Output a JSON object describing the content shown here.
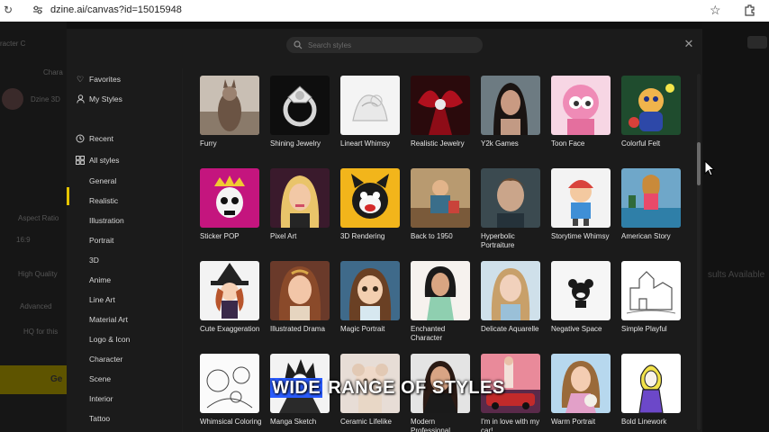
{
  "browser": {
    "url": "dzine.ai/canvas?id=15015948"
  },
  "background": {
    "left_texts": [
      "racter C",
      "Chara",
      "Dzine 3D",
      "Aspect Ratio",
      "16:9",
      "High Quality",
      "Advanced",
      "HQ for this",
      "Ge"
    ],
    "right_texts": [
      "sults Available"
    ]
  },
  "modal": {
    "search_placeholder": "Search styles",
    "sidebar": {
      "favorites": "Favorites",
      "my_styles": "My Styles",
      "recent": "Recent",
      "all_styles": "All styles",
      "categories": [
        "General",
        "Realistic",
        "Illustration",
        "Portrait",
        "3D",
        "Anime",
        "Line Art",
        "Material Art",
        "Logo & Icon",
        "Character",
        "Scene",
        "Interior",
        "Tattoo"
      ]
    },
    "styles": [
      [
        "Furry",
        "Shining Jewelry",
        "Lineart Whimsy",
        "Realistic Jewelry",
        "Y2k Games",
        "Toon Face",
        "Colorful Felt"
      ],
      [
        "Sticker POP",
        "Pixel Art",
        "3D Rendering",
        "Back to 1950",
        "Hyperbolic Portraiture",
        "Storytime Whimsy",
        "American Story"
      ],
      [
        "Cute Exaggeration",
        "Illustrated Drama",
        "Magic Portrait",
        "Enchanted Character",
        "Delicate Aquarelle",
        "Negative Space",
        "Simple Playful"
      ],
      [
        "Whimsical Coloring",
        "Manga Sketch",
        "Ceramic Lifelike",
        "Modern Professional",
        "I'm in love with my car!",
        "Warm Portrait",
        "Bold Linework"
      ]
    ]
  },
  "caption": {
    "highlight": "WIDE",
    "rest": "RANGE OF STYLES"
  },
  "colors": {
    "accent": "#e5c400",
    "caption_highlight": "#2a5cff",
    "modal_bg": "#1b1b1b"
  }
}
